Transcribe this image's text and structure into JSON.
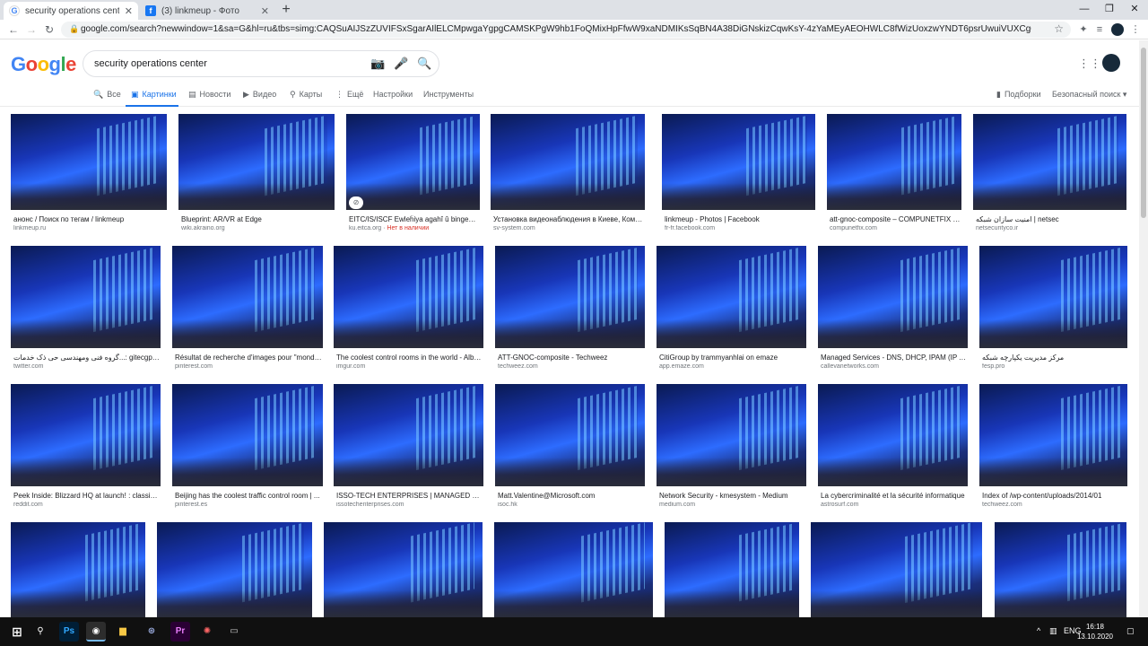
{
  "browser": {
    "tabs": [
      {
        "label": "security operations center – Goo",
        "icon": "google-icon",
        "active": true
      },
      {
        "label": "(3) linkmeup - Фото",
        "icon": "facebook-icon",
        "active": false
      }
    ],
    "url": "google.com/search?newwindow=1&sa=G&hl=ru&tbs=simg:CAQSuAIJSzZUVIFSxSgarAIlELCMpwgaYgpgCAMSKPgW9hb1FoQMixHpFfwW9xaNDMIKsSqBN4A38DiGNskizCqwKsY-4zYaMEyAEOHWLC8fWizUoxzwYNDT6psrUwuiVUXCg6nItS4kAaZskdfzopP6J_1yYEhlxJSAEDAsQjq7-..."
  },
  "search": {
    "logo": "Google",
    "query": "security operations center"
  },
  "filters": {
    "items": [
      {
        "label": "Все",
        "icon": "search-icon"
      },
      {
        "label": "Картинки",
        "icon": "image-icon",
        "active": true
      },
      {
        "label": "Новости",
        "icon": "news-icon"
      },
      {
        "label": "Видео",
        "icon": "video-icon"
      },
      {
        "label": "Карты",
        "icon": "map-pin-icon"
      },
      {
        "label": "Ещё",
        "icon": "more-vert-icon"
      },
      {
        "label": "Настройки"
      },
      {
        "label": "Инструменты"
      }
    ],
    "right": [
      {
        "label": "Подборки",
        "icon": "collections-icon"
      },
      {
        "label": "Безопасный поиск ▾"
      }
    ]
  },
  "results": [
    {
      "caption": "анонс / Поиск по тегам / linkmeup",
      "domain": "linkmeup.ru"
    },
    {
      "caption": "Blueprint: AR/VR at Edge",
      "domain": "wiki.akraino.org"
    },
    {
      "caption": "EITC/IS/ISCF Ewleĥiya agahî û bingehên ...",
      "domain": "ku.eitca.org",
      "note": "Нет в наличии"
    },
    {
      "caption": "Установка видеонаблюдения в Киеве, Компл...",
      "domain": "sv-system.com"
    },
    {
      "caption": "linkmeup - Photos | Facebook",
      "domain": "fr-fr.facebook.com"
    },
    {
      "caption": "att-gnoc-composite – COMPUNETFIX LL...",
      "domain": "compunetfix.com"
    },
    {
      "caption": "امنیت سازان شبکه | netsec",
      "domain": "netsecurityco.ir"
    },
    {
      "caption": "گروه فنی ومهندسی حی ذک خدمات...: gitecgp on Twitter",
      "domain": "twitter.com"
    },
    {
      "caption": "Résultat de recherche d'images pour \"monde ...",
      "domain": "pinterest.com"
    },
    {
      "caption": "The coolest control rooms in the world - Albu...",
      "domain": "imgur.com"
    },
    {
      "caption": "ATT-GNOC-composite - Techweez",
      "domain": "techweez.com"
    },
    {
      "caption": "CitiGroup by trammyanhlai on emaze",
      "domain": "app.emaze.com"
    },
    {
      "caption": "Managed Services - DNS, DHCP, IPAM (IP Add...",
      "domain": "callevanetworks.com"
    },
    {
      "caption": "مرکز مدیریت یکپارچه شبکه",
      "domain": "fesp.pro"
    },
    {
      "caption": "Peek Inside: Blizzard HQ at launch! : classicw...",
      "domain": "reddit.com"
    },
    {
      "caption": "Beijing has the coolest traffic control room | ...",
      "domain": "pinterest.es"
    },
    {
      "caption": "ISSO-TECH ENTERPRISES | MANAGED SERVI...",
      "domain": "issotechenterprises.com"
    },
    {
      "caption": "Matt.Valentine@Microsoft.com",
      "domain": "isoc.hk"
    },
    {
      "caption": "Network Security - kmesystem - Medium",
      "domain": "medium.com"
    },
    {
      "caption": "La cybercriminalité et la sécurité informatique",
      "domain": "astrosurf.com"
    },
    {
      "caption": "Index of /wp-content/uploads/2014/01",
      "domain": "techweez.com"
    },
    {
      "caption": "",
      "domain": ""
    },
    {
      "caption": "",
      "domain": ""
    },
    {
      "caption": "",
      "domain": ""
    },
    {
      "caption": "",
      "domain": ""
    },
    {
      "caption": "",
      "domain": ""
    },
    {
      "caption": "",
      "domain": ""
    },
    {
      "caption": "",
      "domain": ""
    }
  ],
  "taskbar": {
    "apps": [
      "start-icon",
      "search-icon",
      "photoshop-icon",
      "chrome-icon",
      "file-explorer-icon",
      "vpn-icon",
      "premiere-icon",
      "app-icon",
      "screen-icon"
    ],
    "lang": "ENG",
    "time": "16:18",
    "date": "13.10.2020"
  },
  "colors": {
    "accent": "#1a73e8",
    "note": "#d93025"
  }
}
